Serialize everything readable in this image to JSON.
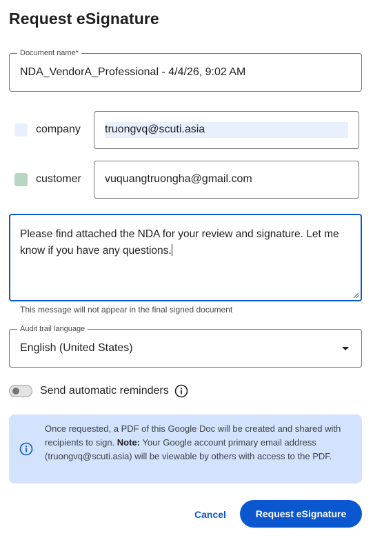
{
  "dialog": {
    "title": "Request eSignature"
  },
  "document_name": {
    "label": "Document name*",
    "value": "NDA_VendorA_Professional - 4/4/26, 9:02 AM"
  },
  "recipients": [
    {
      "role": "company",
      "email": "truongvq@scuti.asia",
      "swatch_color": "#e8f0fe"
    },
    {
      "role": "customer",
      "email": "vuquangtruongha@gmail.com",
      "swatch_color": "#b7d7c2"
    }
  ],
  "message": {
    "value": "Please find attached the NDA for your review and signature. Let me know if you have any questions.",
    "helper": "This message will not appear in the final signed document"
  },
  "audit_trail": {
    "label": "Audit trail language",
    "value": "English (United States)"
  },
  "reminders": {
    "label": "Send automatic reminders",
    "enabled": false
  },
  "info": {
    "text_before": "Once requested, a PDF of this Google Doc will be created and shared with recipients to sign. ",
    "note_label": "Note:",
    "text_after": " Your Google account primary email address (truongvq@scuti.asia) will be viewable by others with access to the PDF."
  },
  "actions": {
    "cancel_label": "Cancel",
    "submit_label": "Request eSignature"
  },
  "colors": {
    "accent": "#0b57d0",
    "info_background": "#d3e3fd"
  }
}
